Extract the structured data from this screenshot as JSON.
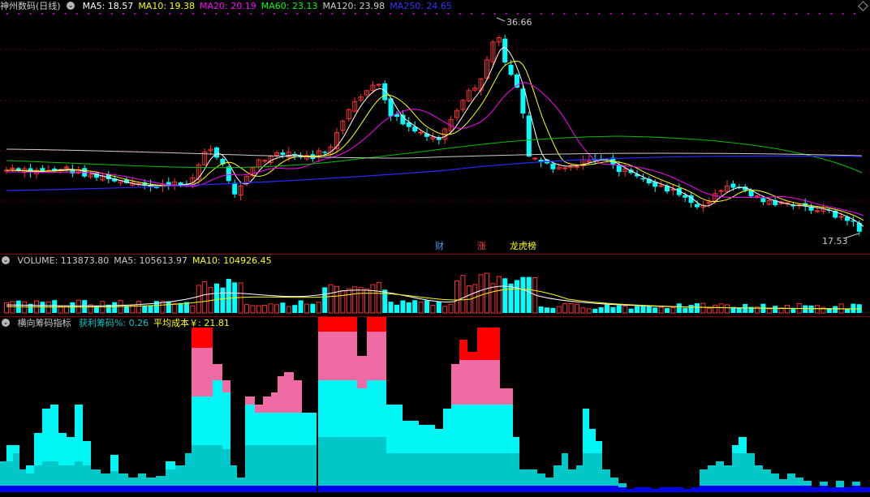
{
  "main": {
    "title": "神州数码(日线)",
    "ma": [
      {
        "label": "MA5: 18.57",
        "color": "#ffffff"
      },
      {
        "label": "MA10: 19.38",
        "color": "#ffff00"
      },
      {
        "label": "MA20: 20.19",
        "color": "#ff00ff"
      },
      {
        "label": "MA60: 23.13",
        "color": "#00ff00"
      },
      {
        "label": "MA120: 23.98",
        "color": "#cccccc"
      },
      {
        "label": "MA250: 24.65",
        "color": "#3333ff"
      }
    ],
    "high_label": "36.66",
    "low_label": "17.53",
    "tags": [
      {
        "text": "财",
        "color": "#3fa0ff"
      },
      {
        "text": "涨",
        "color": "#ff4040"
      },
      {
        "text": "龙虎榜",
        "color": "#ffff00"
      }
    ]
  },
  "volume": {
    "labels": [
      {
        "text": "VOLUME: 113873.80",
        "color": "#cccccc"
      },
      {
        "text": "MA5: 105613.97",
        "color": "#cccccc"
      },
      {
        "text": "MA10: 104926.45",
        "color": "#ffff00"
      }
    ]
  },
  "indicator": {
    "name": "横向筹码指标",
    "labels": [
      {
        "text": "获利筹码%: 0.26",
        "color": "#00c8c8"
      },
      {
        "text": "平均成本￥: 21.81",
        "color": "#ffff00"
      }
    ]
  },
  "colors": {
    "up": "#ff3030",
    "down": "#00ffff",
    "border": "#8b0000",
    "chip_top": "#ff0000",
    "chip_pink": "#f06aa4",
    "chip_cyan": "#00f5f5",
    "chip_teal": "#00c8c8",
    "chip_blue": "#0000ee"
  }
}
